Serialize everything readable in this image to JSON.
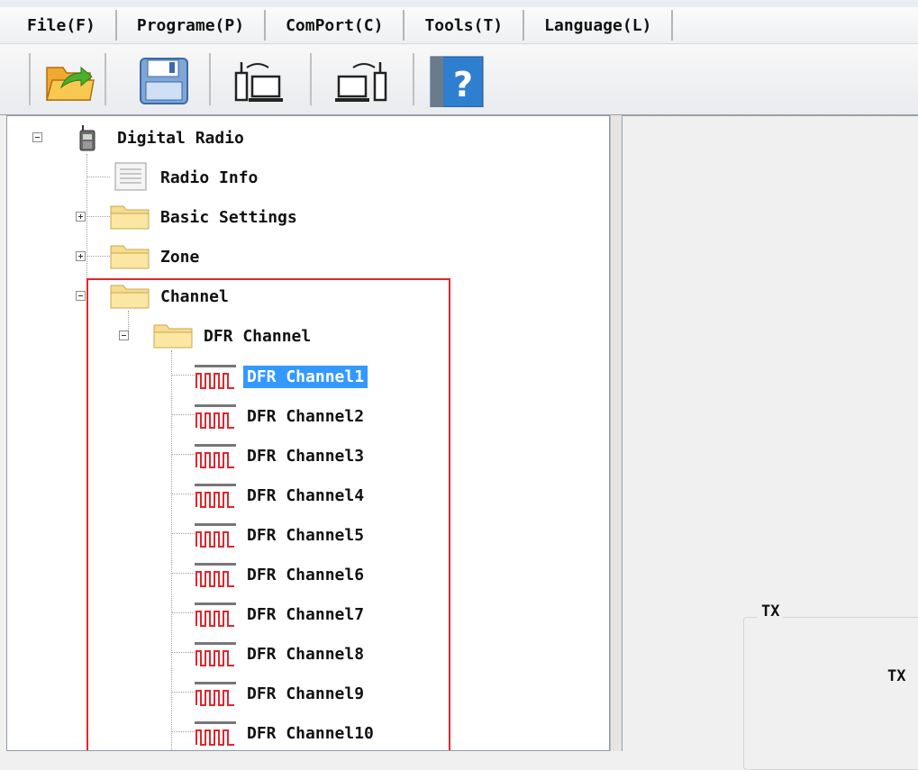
{
  "menu": {
    "items": [
      "File(F)",
      "Programe(P)",
      "ComPort(C)",
      "Tools(T)",
      "Language(L)"
    ]
  },
  "toolbar": {
    "buttons": [
      "open-folder-icon",
      "save-disk-icon",
      "read-radio-icon",
      "write-radio-icon",
      "help-icon"
    ]
  },
  "tree": {
    "root": "Digital Radio",
    "radio_info": "Radio Info",
    "basic_settings": "Basic Settings",
    "zone": "Zone",
    "channel": "Channel",
    "dfr_channel": "DFR Channel",
    "channels": [
      "DFR Channel1",
      "DFR Channel2",
      "DFR Channel3",
      "DFR Channel4",
      "DFR Channel5",
      "DFR Channel6",
      "DFR Channel7",
      "DFR Channel8",
      "DFR Channel9",
      "DFR Channel10"
    ],
    "selected": "DFR Channel1"
  },
  "right_panel": {
    "group_title": "TX",
    "tx_label": "TX"
  },
  "colors": {
    "selection": "#3399ff",
    "highlight_border": "#e0262e",
    "channel_icon": "#e0262e"
  }
}
